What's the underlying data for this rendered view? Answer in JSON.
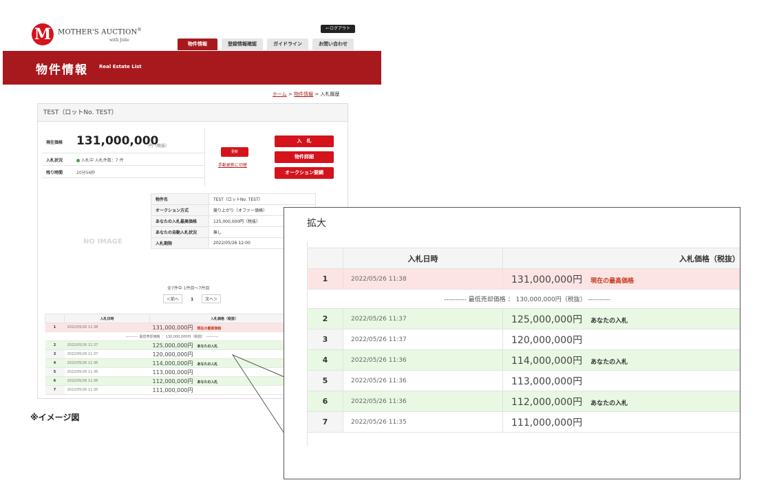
{
  "header": {
    "logo_letter": "M",
    "logo_text": "MOTHER'S AUCTION",
    "logo_registered": "®",
    "logo_sub": "with Jolie",
    "logout_label": "ログアウト",
    "nav": [
      "物件情報",
      "登録情報確認",
      "ガイドライン",
      "お問い合わせ"
    ]
  },
  "banner": {
    "title": "物件情報",
    "subtitle": "Real Estate List"
  },
  "breadcrumb": {
    "home": "ホーム",
    "sep": ">",
    "list": "物件情報",
    "current": "入札履歴"
  },
  "lot": {
    "title": "TEST（ロットNo. TEST）",
    "price_label": "現在価格",
    "price": "131,000,000",
    "price_unit": "円（税抜）",
    "status_label": "入札状況",
    "status_value": "入札中 入札件数：7 件",
    "remaining_label": "残り時間",
    "remaining_value": "20分56秒",
    "refresh_label": "更新",
    "manual_link": "手動更新に切替",
    "bid_button": "入　札",
    "detail_button": "物件詳細",
    "rules_button": "オークション要綱",
    "no_image": "NO IMAGE",
    "details": [
      {
        "k": "物件名",
        "v": "TEST（ロットNo. TEST）"
      },
      {
        "k": "オークション方式",
        "v": "競り上がり（オファー価格）"
      },
      {
        "k": "あなたの入札最高価格",
        "v": "125,000,000円（税抜）"
      },
      {
        "k": "あなたの自動入札状況",
        "v": "無し"
      },
      {
        "k": "入札期限",
        "v": "2022/05/26 12:00"
      }
    ],
    "pager_info": "全7件中 1件目～7件目",
    "prev": "＜前へ",
    "page": "1",
    "next": "次へ＞"
  },
  "caption": "※イメージ図",
  "zoom_title": "拡大",
  "bid_table": {
    "h_date": "入札日時",
    "h_price": "入札価格（税抜）",
    "min_price": "---------- 最低売却価格 ： 130,000,000円（税抜） ----------",
    "tag_top": "現在の最高価格",
    "tag_mine": "あなたの入札",
    "rows": [
      {
        "n": "1",
        "date": "2022/05/26 11:38",
        "price": "131,000,000円",
        "tag": "現在の最高価格"
      },
      {
        "n": "2",
        "date": "2022/05/26 11:37",
        "price": "125,000,000円",
        "tag": "あなたの入札"
      },
      {
        "n": "3",
        "date": "2022/05/26 11:37",
        "price": "120,000,000円",
        "tag": ""
      },
      {
        "n": "4",
        "date": "2022/05/26 11:36",
        "price": "114,000,000円",
        "tag": "あなたの入札"
      },
      {
        "n": "5",
        "date": "2022/05/26 11:36",
        "price": "113,000,000円",
        "tag": ""
      },
      {
        "n": "6",
        "date": "2022/05/26 11:36",
        "price": "112,000,000円",
        "tag": "あなたの入札"
      },
      {
        "n": "7",
        "date": "2022/05/26 11:35",
        "price": "111,000,000円",
        "tag": ""
      }
    ]
  }
}
